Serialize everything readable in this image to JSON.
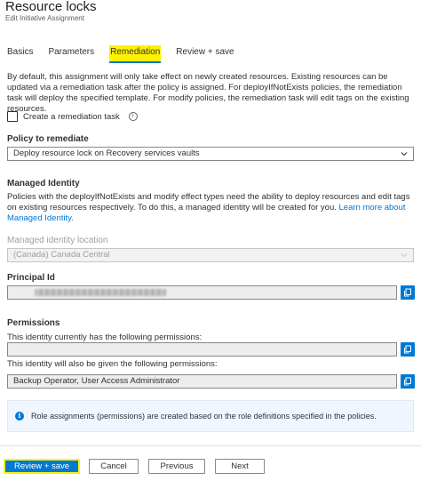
{
  "header": {
    "title": "Resource locks",
    "subtitle": "Edit Initiative Assignment"
  },
  "tabs": [
    {
      "label": "Basics",
      "active": false
    },
    {
      "label": "Parameters",
      "active": false
    },
    {
      "label": "Remediation",
      "active": true
    },
    {
      "label": "Review + save",
      "active": false
    }
  ],
  "remediation": {
    "intro": "By default, this assignment will only take effect on newly created resources. Existing resources can be updated via a remediation task after the policy is assigned. For deployIfNotExists policies, the remediation task will deploy the specified template. For modify policies, the remediation task will edit tags on the existing resources.",
    "create_task_label": "Create a remediation task",
    "policy_label": "Policy to remediate",
    "policy_value": "Deploy resource lock on Recovery services vaults"
  },
  "identity": {
    "heading": "Managed Identity",
    "description": "Policies with the deployIfNotExists and modify effect types need the ability to deploy resources and edit tags on existing resources respectively. To do this, a managed identity will be created for you.",
    "learn_more": "Learn more about Managed Identity.",
    "location_label": "Managed identity location",
    "location_value": "(Canada) Canada Central",
    "principal_label": "Principal Id"
  },
  "permissions": {
    "heading": "Permissions",
    "current_label": "This identity currently has the following permissions:",
    "current_value": "",
    "given_label": "This identity will also be given the following permissions:",
    "given_value": "Backup Operator, User Access Administrator"
  },
  "info": {
    "text": "Role assignments (permissions) are created based on the role definitions specified in the policies."
  },
  "footer": {
    "review_save": "Review + save",
    "cancel": "Cancel",
    "previous": "Previous",
    "next": "Next"
  },
  "colors": {
    "accent": "#0078d4",
    "highlight": "#fff200"
  }
}
